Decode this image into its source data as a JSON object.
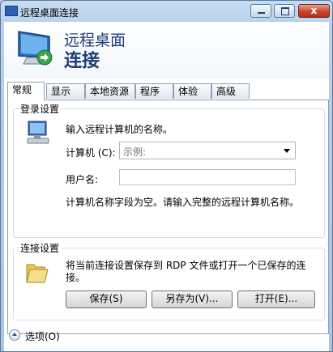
{
  "window": {
    "title": "远程桌面连接",
    "close_symbol": "x"
  },
  "header": {
    "line1": "远程桌面",
    "line2": "连接"
  },
  "tabs": [
    "常规",
    "显示",
    "本地资源",
    "程序",
    "体验",
    "高级"
  ],
  "login": {
    "group_label": "登录设置",
    "prompt": "输入远程计算机的名称。",
    "computer_label": "计算机 (C):",
    "computer_value": "示例:",
    "username_label": "用户名:",
    "username_value": "",
    "warning": "计算机名称字段为空。请输入完整的远程计算机名称。"
  },
  "connection": {
    "group_label": "连接设置",
    "description_line1": "将当前连接设置保存到 RDP 文件或打开一个已保存的连",
    "description_line2": "接。",
    "save": "保存(S)",
    "save_as": "另存为(V)...",
    "open": "打开(E)..."
  },
  "footer": {
    "options": "选项(O)"
  }
}
